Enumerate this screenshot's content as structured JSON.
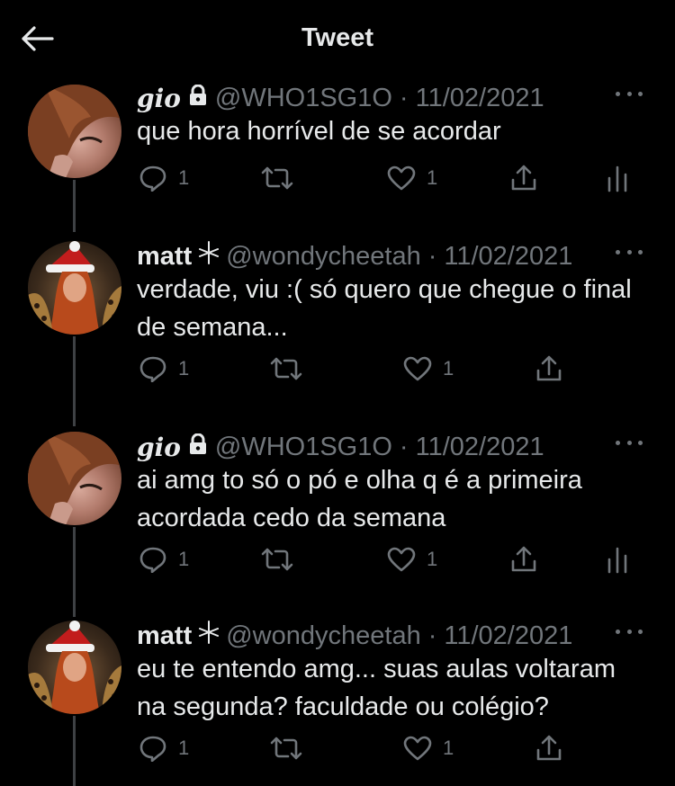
{
  "header": {
    "title": "Tweet",
    "back_icon": "arrow-left-icon"
  },
  "colors": {
    "background": "#000000",
    "text": "#e7e9ea",
    "secondary": "#71767b",
    "thread_line": "#3e4144"
  },
  "tweets": [
    {
      "name": "gio",
      "badge_icon": "lock-icon",
      "handle": "@WHO1SG1O",
      "separator": "·",
      "date": "11/02/2021",
      "text": "que hora horrível de se acordar",
      "reply_count": "1",
      "like_count": "1",
      "show_analytics": true
    },
    {
      "name": "matt",
      "badge_icon": "sparkle-star-icon",
      "handle": "@wondycheetah",
      "separator": "·",
      "date": "11/02/2021",
      "text": "verdade, viu :( só quero que chegue o final de semana...",
      "reply_count": "1",
      "like_count": "1",
      "show_analytics": false
    },
    {
      "name": "gio",
      "badge_icon": "lock-icon",
      "handle": "@WHO1SG1O",
      "separator": "·",
      "date": "11/02/2021",
      "text": "ai amg to só o pó e olha q é a primeira acordada cedo da semana",
      "reply_count": "1",
      "like_count": "1",
      "show_analytics": true
    },
    {
      "name": "matt",
      "badge_icon": "sparkle-star-icon",
      "handle": "@wondycheetah",
      "separator": "·",
      "date": "11/02/2021",
      "text": "eu te entendo amg... suas aulas voltaram na segunda? faculdade ou colégio?",
      "reply_count": "1",
      "like_count": "1",
      "show_analytics": false
    }
  ]
}
